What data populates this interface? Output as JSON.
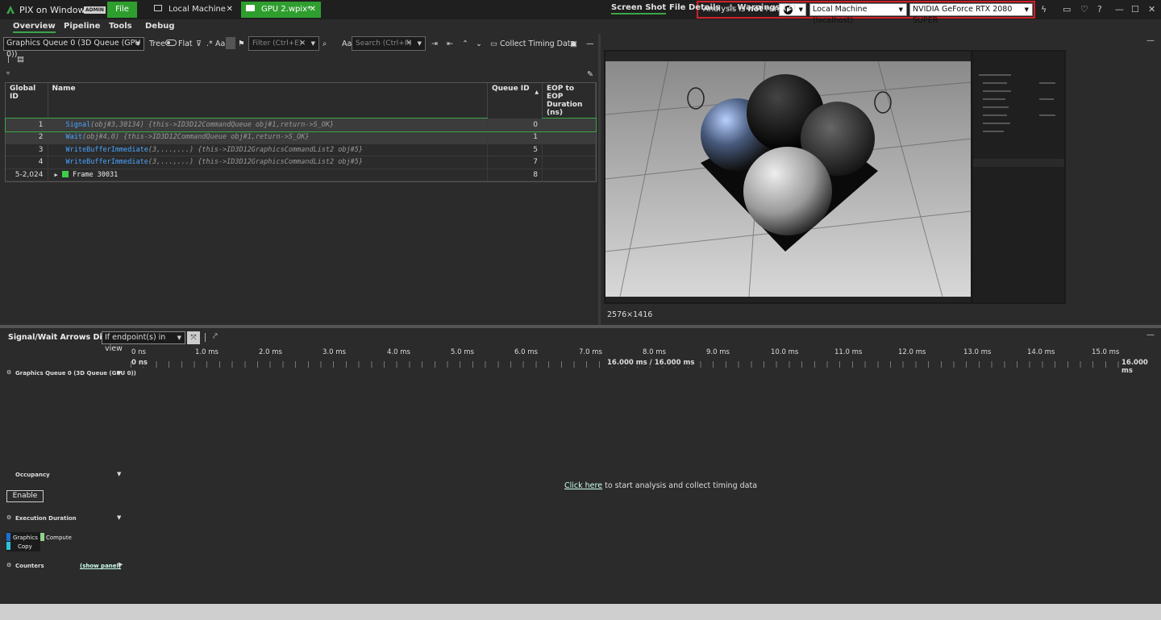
{
  "titlebar": {
    "app_title": "PIX on Windows",
    "admin_badge": "ADMIN",
    "file_tab": "File",
    "tabs": [
      {
        "label": "Local Machine",
        "icon": "monitor-icon"
      },
      {
        "label": "GPU 2.wpix*",
        "icon": "camera-icon"
      }
    ],
    "analysis_prefix": "Analysis is ",
    "analysis_bold": "not",
    "analysis_suffix": " running",
    "machine": "Local Machine (localhost)",
    "gpu": "NVIDIA GeForce RTX 2080 SUPER",
    "window_controls": [
      "minimize",
      "maximize",
      "close"
    ]
  },
  "menu": [
    "Overview",
    "Pipeline",
    "Tools",
    "Debug"
  ],
  "toolbar": {
    "queue": "Graphics Queue 0 (3D Queue (GPU 0))",
    "tree": "Tree",
    "flat": "Flat",
    "aa": "Aa",
    "filter_placeholder": "Filter (Ctrl+E)",
    "search_placeholder": "Search (Ctrl+F)",
    "collect": "Collect Timing Data"
  },
  "table": {
    "headers": [
      "Global ID",
      "Name",
      "Queue ID",
      "EOP to EOP Duration (ns)"
    ],
    "rows": [
      {
        "gid": "1",
        "fn": "Signal",
        "params": "(obj#3,30134)",
        "info": "{this->ID3D12CommandQueue obj#1,return->S_OK}",
        "qid": "0"
      },
      {
        "gid": "2",
        "fn": "Wait",
        "params": "(obj#4,0)",
        "info": "{this->ID3D12CommandQueue obj#1,return->S_OK}",
        "qid": "1"
      },
      {
        "gid": "3",
        "fn": "WriteBufferImmediate",
        "params": "(3,...,...)",
        "info": "{this->ID3D12GraphicsCommandList2 obj#5}",
        "qid": "5"
      },
      {
        "gid": "4",
        "fn": "WriteBufferImmediate",
        "params": "(3,...,...)",
        "info": "{this->ID3D12GraphicsCommandList2 obj#5}",
        "qid": "7"
      },
      {
        "gid": "5-2,024",
        "fn": "Frame 30031",
        "params": "",
        "info": "",
        "qid": "8"
      }
    ]
  },
  "right_tabs": {
    "screenshot": "Screen Shot",
    "details": "File Details",
    "warnings": "Warnings (2)"
  },
  "screenshot": {
    "size": "2576×1416"
  },
  "timeline": {
    "sw_label": "Signal/Wait Arrows Display",
    "sw_value": "If endpoint(s) in view",
    "ticks": [
      "0 ns",
      "1.0 ms",
      "2.0 ms",
      "3.0 ms",
      "4.0 ms",
      "5.0 ms",
      "6.0 ms",
      "7.0 ms",
      "8.0 ms",
      "9.0 ms",
      "10.0 ms",
      "11.0 ms",
      "12.0 ms",
      "13.0 ms",
      "14.0 ms",
      "15.0 ms"
    ],
    "start": "0 ns",
    "mid": "16.000 ms / 16.000 ms",
    "end": "16.000 ms",
    "queue_track": "Graphics Queue 0 (3D Queue (GPU 0))",
    "occupancy": "Occupancy",
    "enable": "Enable",
    "exec_duration": "Execution Duration",
    "legend": [
      {
        "label": "Graphics",
        "color": "#1e6fd0"
      },
      {
        "label": "Compute",
        "color": "#8fd48a"
      },
      {
        "label": "Copy",
        "color": "#2ec4d8"
      }
    ],
    "counters": "Counters",
    "show_panel": "(show panel)",
    "click_link": "Click here",
    "click_rest": " to start analysis and collect timing data"
  }
}
